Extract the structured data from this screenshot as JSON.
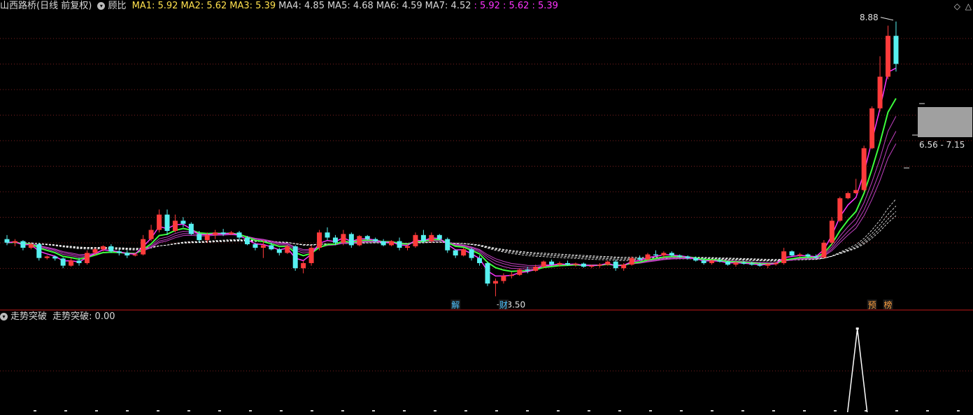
{
  "main_header": {
    "stock": "山西路桥",
    "period": "(日线 前复权)",
    "indicator": "顾比",
    "ma": [
      {
        "label": "MA1:",
        "value": "5.92",
        "color": "#ffe14d"
      },
      {
        "label": "MA2:",
        "value": "5.62",
        "color": "#ffe14d"
      },
      {
        "label": "MA3:",
        "value": "5.39",
        "color": "#ffe14d"
      },
      {
        "label": "MA4:",
        "value": "4.85",
        "color": "#d8d8d8"
      },
      {
        "label": "MA5:",
        "value": "4.68",
        "color": "#d8d8d8"
      },
      {
        "label": "MA6:",
        "value": "4.59",
        "color": "#d8d8d8"
      },
      {
        "label": "MA7:",
        "value": "4.52",
        "color": "#d8d8d8"
      }
    ],
    "extra": [
      {
        "label": ":",
        "value": "5.92"
      },
      {
        "label": ":",
        "value": "5.62"
      },
      {
        "label": ":",
        "value": "5.39"
      }
    ]
  },
  "sub_header": {
    "indicator": "走势突破",
    "label": "走势突破:",
    "value": "0.00"
  },
  "annotations": {
    "high_label": "8.88",
    "low_label": "3.50",
    "range_label": "6.56 - 7.15",
    "event_markers": [
      {
        "text": "解",
        "bar": 56,
        "color": "#4dc3ff"
      },
      {
        "text": "财",
        "bar": 62,
        "color": "#4dc3ff"
      },
      {
        "text": "预",
        "bar": 108,
        "color": "#ffa040"
      },
      {
        "text": "榜",
        "bar": 110,
        "color": "#ffa040"
      }
    ]
  },
  "colors": {
    "up": "#ff3b3b",
    "down": "#57f0f0",
    "flat": "#ffff33",
    "ma_fast": "#ff33ff",
    "ma_mid": "#3cff3c",
    "ma_slow": "#ffffff",
    "grid": "#7a1f1f",
    "divider": "#c01818"
  },
  "chart_data": [
    {
      "type": "candlestick",
      "panel": "main",
      "ylim": [
        3.3,
        9.0
      ],
      "grid": "dotted-horizontal",
      "ohlc": [
        [
          4.62,
          4.7,
          4.5,
          4.55
        ],
        [
          4.55,
          4.62,
          4.48,
          4.58
        ],
        [
          4.58,
          4.6,
          4.4,
          4.45
        ],
        [
          4.45,
          4.55,
          4.42,
          4.52
        ],
        [
          4.52,
          4.55,
          4.2,
          4.25
        ],
        [
          4.25,
          4.3,
          4.22,
          4.28
        ],
        [
          4.28,
          4.3,
          4.2,
          4.24
        ],
        [
          4.24,
          4.26,
          4.05,
          4.1
        ],
        [
          4.1,
          4.25,
          4.08,
          4.2
        ],
        [
          4.2,
          4.25,
          4.1,
          4.15
        ],
        [
          4.15,
          4.4,
          4.12,
          4.35
        ],
        [
          4.35,
          4.45,
          4.3,
          4.42
        ],
        [
          4.42,
          4.5,
          4.38,
          4.48
        ],
        [
          4.48,
          4.52,
          4.35,
          4.38
        ],
        [
          4.38,
          4.42,
          4.3,
          4.35
        ],
        [
          4.35,
          4.4,
          4.25,
          4.3
        ],
        [
          4.3,
          4.35,
          4.28,
          4.32
        ],
        [
          4.32,
          4.7,
          4.3,
          4.62
        ],
        [
          4.62,
          4.9,
          4.58,
          4.8
        ],
        [
          4.8,
          5.2,
          4.75,
          5.1
        ],
        [
          5.1,
          5.2,
          4.7,
          4.78
        ],
        [
          4.78,
          5.1,
          4.75,
          4.98
        ],
        [
          4.98,
          5.05,
          4.85,
          4.92
        ],
        [
          4.92,
          4.95,
          4.7,
          4.72
        ],
        [
          4.72,
          4.78,
          4.55,
          4.6
        ],
        [
          4.6,
          4.75,
          4.55,
          4.7
        ],
        [
          4.7,
          4.8,
          4.62,
          4.75
        ],
        [
          4.75,
          4.82,
          4.68,
          4.72
        ],
        [
          4.72,
          4.78,
          4.7,
          4.75
        ],
        [
          4.75,
          4.78,
          4.6,
          4.65
        ],
        [
          4.65,
          4.68,
          4.5,
          4.52
        ],
        [
          4.52,
          4.55,
          4.4,
          4.45
        ],
        [
          4.45,
          4.6,
          4.25,
          4.5
        ],
        [
          4.5,
          4.55,
          4.4,
          4.42
        ],
        [
          4.42,
          4.45,
          4.3,
          4.35
        ],
        [
          4.35,
          4.5,
          4.33,
          4.48
        ],
        [
          4.48,
          4.5,
          4.0,
          4.05
        ],
        [
          4.05,
          4.2,
          3.95,
          4.15
        ],
        [
          4.15,
          4.5,
          4.1,
          4.45
        ],
        [
          4.45,
          4.8,
          4.4,
          4.75
        ],
        [
          4.75,
          4.85,
          4.6,
          4.65
        ],
        [
          4.65,
          4.7,
          4.5,
          4.55
        ],
        [
          4.55,
          4.8,
          4.5,
          4.72
        ],
        [
          4.72,
          4.75,
          4.45,
          4.5
        ],
        [
          4.5,
          4.7,
          4.48,
          4.68
        ],
        [
          4.68,
          4.7,
          4.6,
          4.62
        ],
        [
          4.62,
          4.65,
          4.55,
          4.58
        ],
        [
          4.58,
          4.62,
          4.48,
          4.5
        ],
        [
          4.5,
          4.6,
          4.48,
          4.58
        ],
        [
          4.58,
          4.65,
          4.4,
          4.45
        ],
        [
          4.45,
          4.52,
          4.4,
          4.48
        ],
        [
          4.48,
          4.75,
          4.45,
          4.7
        ],
        [
          4.7,
          4.8,
          4.55,
          4.58
        ],
        [
          4.58,
          4.75,
          4.55,
          4.7
        ],
        [
          4.7,
          4.72,
          4.6,
          4.62
        ],
        [
          4.62,
          4.65,
          4.35,
          4.4
        ],
        [
          4.4,
          4.42,
          4.25,
          4.3
        ],
        [
          4.3,
          4.45,
          4.28,
          4.42
        ],
        [
          4.42,
          4.45,
          4.2,
          4.25
        ],
        [
          4.25,
          4.3,
          4.1,
          4.15
        ],
        [
          4.15,
          4.18,
          3.7,
          3.75
        ],
        [
          3.75,
          3.85,
          3.5,
          3.8
        ],
        [
          3.8,
          3.95,
          3.75,
          3.9
        ],
        [
          3.9,
          3.98,
          3.85,
          3.92
        ],
        [
          3.92,
          4.05,
          3.9,
          4.02
        ],
        [
          4.02,
          4.08,
          3.95,
          4.0
        ],
        [
          4.0,
          4.12,
          3.98,
          4.08
        ],
        [
          4.08,
          4.2,
          4.05,
          4.18
        ],
        [
          4.18,
          4.22,
          4.1,
          4.12
        ],
        [
          4.12,
          4.18,
          4.08,
          4.15
        ],
        [
          4.15,
          4.2,
          4.1,
          4.12
        ],
        [
          4.12,
          4.16,
          4.08,
          4.14
        ],
        [
          4.14,
          4.16,
          4.06,
          4.08
        ],
        [
          4.08,
          4.12,
          4.05,
          4.1
        ],
        [
          4.1,
          4.15,
          4.06,
          4.12
        ],
        [
          4.12,
          4.2,
          4.1,
          4.18
        ],
        [
          4.18,
          4.22,
          4.0,
          4.05
        ],
        [
          4.05,
          4.15,
          4.0,
          4.12
        ],
        [
          4.12,
          4.28,
          4.1,
          4.25
        ],
        [
          4.25,
          4.3,
          4.2,
          4.22
        ],
        [
          4.22,
          4.35,
          4.2,
          4.32
        ],
        [
          4.32,
          4.4,
          4.28,
          4.3
        ],
        [
          4.3,
          4.38,
          4.25,
          4.35
        ],
        [
          4.35,
          4.38,
          4.28,
          4.3
        ],
        [
          4.3,
          4.32,
          4.25,
          4.28
        ],
        [
          4.28,
          4.3,
          4.22,
          4.25
        ],
        [
          4.25,
          4.28,
          4.18,
          4.2
        ],
        [
          4.2,
          4.25,
          4.12,
          4.15
        ],
        [
          4.15,
          4.22,
          4.12,
          4.2
        ],
        [
          4.2,
          4.25,
          4.16,
          4.18
        ],
        [
          4.18,
          4.2,
          4.1,
          4.12
        ],
        [
          4.12,
          4.18,
          4.08,
          4.16
        ],
        [
          4.16,
          4.2,
          4.12,
          4.14
        ],
        [
          4.14,
          4.18,
          4.1,
          4.12
        ],
        [
          4.12,
          4.16,
          4.08,
          4.1
        ],
        [
          4.1,
          4.15,
          4.05,
          4.13
        ],
        [
          4.13,
          4.18,
          4.1,
          4.15
        ],
        [
          4.15,
          4.45,
          4.12,
          4.38
        ],
        [
          4.38,
          4.4,
          4.28,
          4.3
        ],
        [
          4.3,
          4.35,
          4.26,
          4.32
        ],
        [
          4.32,
          4.34,
          4.25,
          4.28
        ],
        [
          4.28,
          4.32,
          4.24,
          4.26
        ],
        [
          4.26,
          4.6,
          4.24,
          4.55
        ],
        [
          4.55,
          5.05,
          4.5,
          4.98
        ],
        [
          4.98,
          5.45,
          4.95,
          5.42
        ],
        [
          5.42,
          5.55,
          5.4,
          5.52
        ],
        [
          5.52,
          5.8,
          5.5,
          5.58
        ],
        [
          5.58,
          6.45,
          5.55,
          6.4
        ],
        [
          6.4,
          7.22,
          6.38,
          7.18
        ],
        [
          7.18,
          8.2,
          7.12,
          7.8
        ],
        [
          7.8,
          8.8,
          7.75,
          8.6
        ],
        [
          8.6,
          8.88,
          7.9,
          8.05
        ]
      ],
      "indicators": {
        "short_group": "3 lines (magenta)",
        "long_group": "4 lines (dashed white)"
      }
    },
    {
      "type": "line",
      "panel": "sub",
      "name": "走势突破",
      "value_latest": "0.00",
      "spike_at_bar": 106
    }
  ]
}
